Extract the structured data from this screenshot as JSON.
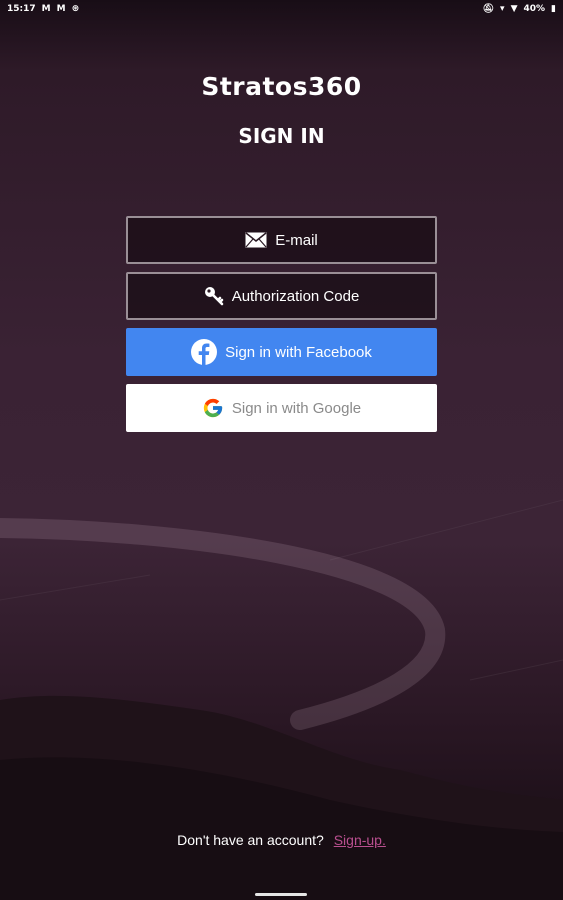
{
  "status_bar": {
    "time": "15:17",
    "battery": "40%",
    "left_icons": [
      "gmail-icon",
      "gmail-icon",
      "sync-icon"
    ],
    "right_icons": [
      "mute-icon",
      "signal-icon",
      "wifi-icon",
      "battery-icon"
    ]
  },
  "app": {
    "title": "Stratos360",
    "page_title": "SIGN IN"
  },
  "buttons": {
    "email": {
      "label": "E-mail",
      "icon": "envelope-icon"
    },
    "auth_code": {
      "label": "Authorization Code",
      "icon": "key-icon"
    },
    "facebook": {
      "label": "Sign in with Facebook",
      "icon": "facebook-icon",
      "color": "#4286f0"
    },
    "google": {
      "label": "Sign in with Google",
      "icon": "google-icon",
      "color": "#ffffff"
    }
  },
  "footer": {
    "prompt": "Don't have an account?",
    "signup_label": "Sign-up.",
    "signup_color": "#b94f8f"
  }
}
